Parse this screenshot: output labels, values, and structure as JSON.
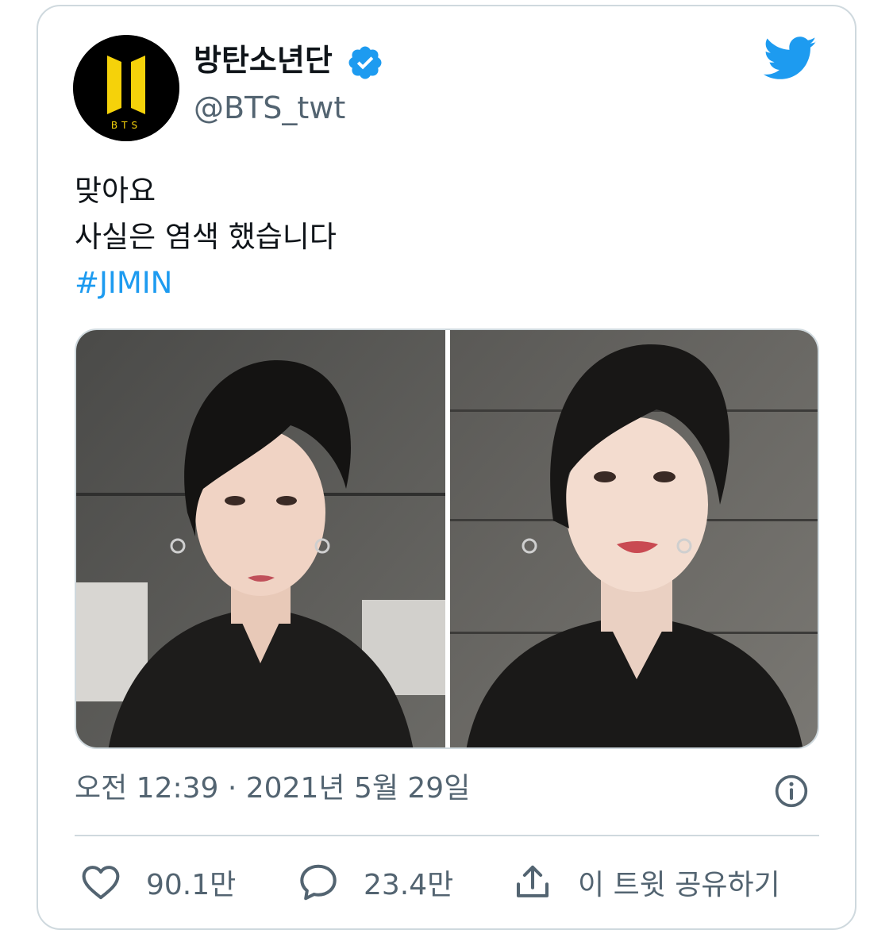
{
  "tweet": {
    "author": {
      "display_name": "방탄소년단",
      "handle": "@BTS_twt",
      "verified": true,
      "avatar_logo_text": "BTS"
    },
    "text_lines": [
      "맞아요",
      "사실은 염색 했습니다"
    ],
    "hashtag": "#JIMIN",
    "timestamp": "오전 12:39 · 2021년 5월 29일",
    "actions": {
      "like_count": "90.1만",
      "reply_count": "23.4만",
      "share_label": "이 트윗 공유하기"
    }
  },
  "icons": {
    "brand": "twitter-bird-icon",
    "verified": "verified-badge-icon",
    "info": "info-icon",
    "like": "heart-icon",
    "reply": "speech-bubble-icon",
    "share": "share-icon"
  },
  "colors": {
    "accent": "#1d9bf0",
    "text": "#0f1419",
    "muted": "#536471",
    "border": "#cfd9de",
    "logo_yellow": "#f5d20a"
  }
}
